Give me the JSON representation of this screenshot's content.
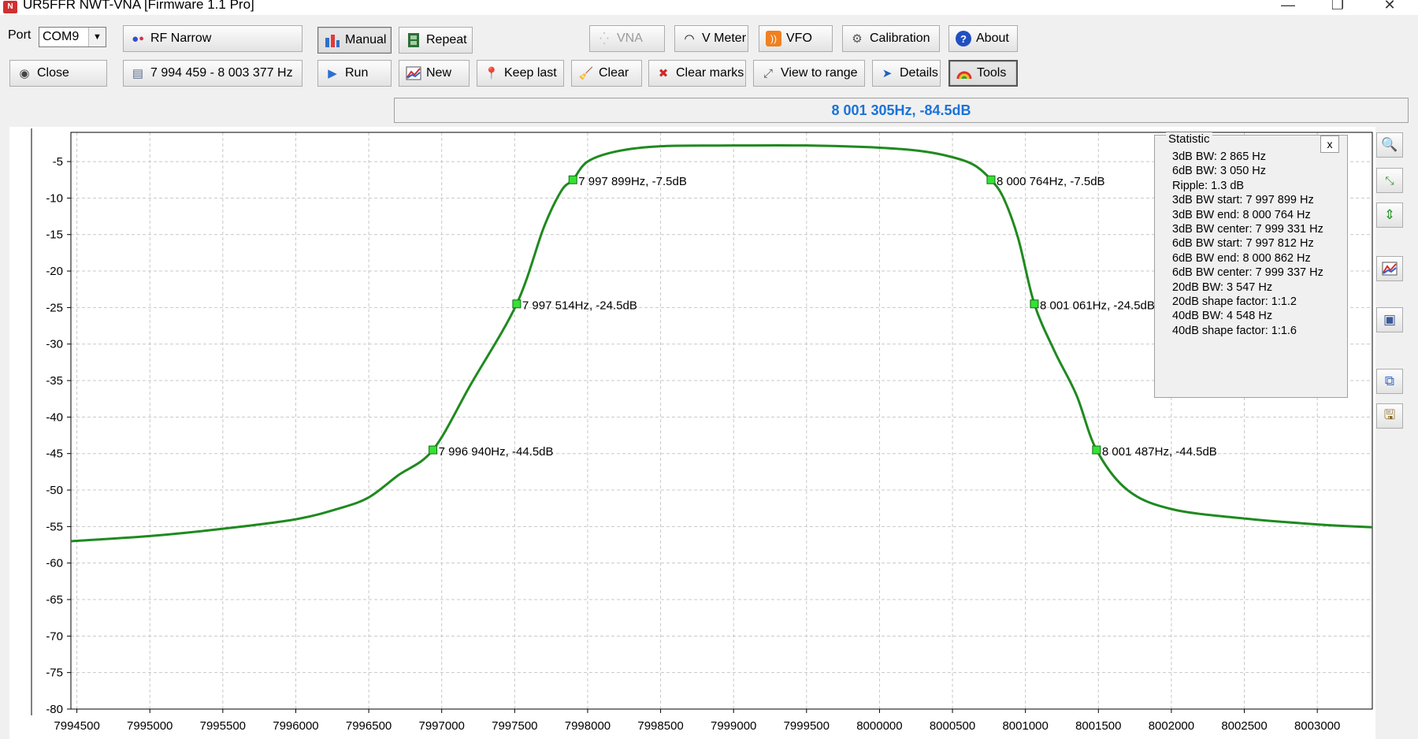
{
  "window": {
    "title": "UR5FFR NWT-VNA [Firmware 1.1 Pro]",
    "minimize": "—",
    "restore": "❐",
    "close": "✕"
  },
  "toolbar": {
    "port_label": "Port",
    "port_value": "COM9",
    "mode": "RF Narrow",
    "manual": "Manual",
    "repeat": "Repeat",
    "vna": "VNA",
    "vmeter": "V Meter",
    "vfo": "VFO",
    "calibration": "Calibration",
    "about": "About",
    "close": "Close",
    "range": "7 994 459 - 8 003 377 Hz",
    "run": "Run",
    "new": "New",
    "keep_last": "Keep last",
    "clear": "Clear",
    "clear_marks": "Clear marks",
    "view_to_range": "View to range",
    "details": "Details",
    "tools": "Tools"
  },
  "readout": "8 001 305Hz, -84.5dB",
  "statistic": {
    "title": "Statistic",
    "close": "x",
    "lines": [
      "3dB BW: 2 865 Hz",
      "6dB BW: 3 050 Hz",
      "Ripple: 1.3 dB",
      "3dB BW start: 7 997 899 Hz",
      "3dB BW end: 8 000 764 Hz",
      "3dB BW center: 7 999 331 Hz",
      "6dB BW start: 7 997 812 Hz",
      "6dB BW end: 8 000 862 Hz",
      "6dB BW center: 7 999 337 Hz",
      "20dB BW: 3 547 Hz",
      "20dB shape factor: 1:1.2",
      "40dB BW: 4 548 Hz",
      "40dB shape factor: 1:1.6"
    ]
  },
  "colors": {
    "trace": "#1f8a1f",
    "marker": "#33e233",
    "readout": "#1a72d8",
    "grid": "#c8c8c8"
  },
  "chart_data": {
    "type": "line",
    "xlim": [
      7994459,
      8003377
    ],
    "ylim": [
      -80,
      -1
    ],
    "grid": true,
    "x_ticks": [
      7994500,
      7995000,
      7995500,
      7996000,
      7996500,
      7997000,
      7997500,
      7998000,
      7998500,
      7999000,
      7999500,
      8000000,
      8000500,
      8001000,
      8001500,
      8002000,
      8002500,
      8003000
    ],
    "y_ticks": [
      -5,
      -10,
      -15,
      -20,
      -25,
      -30,
      -35,
      -40,
      -45,
      -50,
      -55,
      -60,
      -65,
      -70,
      -75,
      -80
    ],
    "series": [
      {
        "x": [
          7994459,
          7995000,
          7995500,
          7996000,
          7996300,
          7996500,
          7996700,
          7996940,
          7997200,
          7997514,
          7997700,
          7997820,
          7997899,
          7998000,
          7998200,
          7998500,
          7999000,
          7999500,
          8000000,
          8000300,
          8000500,
          8000650,
          8000764,
          8000850,
          8000950,
          8001061,
          8001200,
          8001350,
          8001487,
          8001700,
          8002000,
          8002500,
          8003000,
          8003377
        ],
        "y": [
          -57,
          -56.3,
          -55.3,
          -54.0,
          -52.5,
          -51.0,
          -48.0,
          -44.5,
          -35.5,
          -24.5,
          -14.0,
          -9.0,
          -7.5,
          -5.0,
          -3.6,
          -2.9,
          -2.8,
          -2.8,
          -3.1,
          -3.6,
          -4.4,
          -5.5,
          -7.5,
          -10.0,
          -15.5,
          -24.5,
          -31.0,
          -37.0,
          -44.5,
          -50.0,
          -52.6,
          -53.9,
          -54.7,
          -55.1
        ]
      }
    ],
    "markers": [
      {
        "x": 7996940,
        "y": -44.5,
        "label": "7 996 940Hz, -44.5dB"
      },
      {
        "x": 7997514,
        "y": -24.5,
        "label": "7 997 514Hz, -24.5dB"
      },
      {
        "x": 7997899,
        "y": -7.5,
        "label": "7 997 899Hz, -7.5dB"
      },
      {
        "x": 8000764,
        "y": -7.5,
        "label": "8 000 764Hz, -7.5dB"
      },
      {
        "x": 8001061,
        "y": -24.5,
        "label": "8 001 061Hz, -24.5dB"
      },
      {
        "x": 8001487,
        "y": -44.5,
        "label": "8 001 487Hz, -44.5dB"
      }
    ]
  },
  "side_icons": [
    "zoom-icon",
    "fit-icon",
    "vertical-scale-icon",
    "chart-icon",
    "camera-icon",
    "copy-icon",
    "save-icon"
  ]
}
